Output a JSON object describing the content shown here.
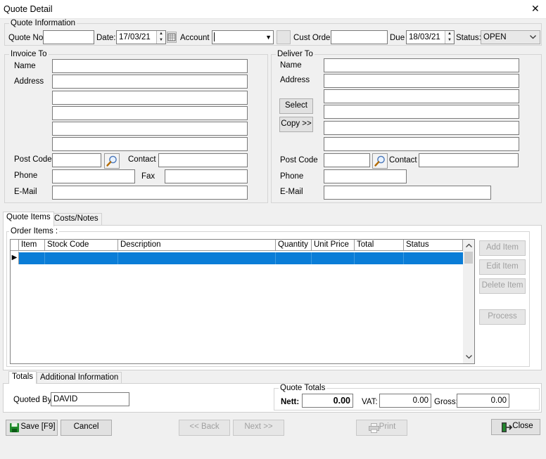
{
  "window": {
    "title": "Quote Detail",
    "close_glyph": "✕"
  },
  "quote_info": {
    "title": "Quote Information",
    "quote_no_label": "Quote No",
    "quote_no_value": "",
    "date_label": "Date:",
    "date_value": "17/03/21",
    "account_label": "Account",
    "account_value": "",
    "cust_order_label": "Cust Order",
    "cust_order_value": "",
    "due_label": "Due",
    "due_value": "18/03/21",
    "status_label": "Status:",
    "status_value": "OPEN"
  },
  "invoice_to": {
    "title": "Invoice To",
    "name_label": "Name",
    "address_label": "Address",
    "post_code_label": "Post Code",
    "contact_label": "Contact",
    "phone_label": "Phone",
    "fax_label": "Fax",
    "email_label": "E-Mail"
  },
  "deliver_to": {
    "title": "Deliver To",
    "name_label": "Name",
    "address_label": "Address",
    "select_button": "Select",
    "copy_button": "Copy >>",
    "post_code_label": "Post Code",
    "contact_label": "Contact",
    "phone_label": "Phone",
    "email_label": "E-Mail"
  },
  "tabs": {
    "quote_items": "Quote Items",
    "costs_notes": "Costs/Notes"
  },
  "order_items": {
    "title": "Order Items :",
    "columns": [
      "Item",
      "Stock Code",
      "Description",
      "Quantity",
      "Unit Price",
      "Total",
      "Status"
    ],
    "row_indicator": "▶",
    "add_item": "Add Item",
    "edit_item": "Edit Item",
    "delete_item": "Delete Item",
    "process": "Process"
  },
  "bottom_tabs": {
    "totals": "Totals",
    "additional": "Additional Information"
  },
  "totals": {
    "quoted_by_label": "Quoted By:",
    "quoted_by_value": "DAVID",
    "group_title": "Quote Totals",
    "nett_label": "Nett:",
    "nett_value": "0.00",
    "vat_label": "VAT:",
    "vat_value": "0.00",
    "gross_label": "Gross:",
    "gross_value": "0.00"
  },
  "footer": {
    "save": "Save [F9]",
    "cancel": "Cancel",
    "back": "<< Back",
    "next": "Next >>",
    "print": "Print",
    "close": "Close"
  },
  "colors": {
    "selection": "#0a7dd7",
    "save_icon": "#1f8a2a"
  }
}
